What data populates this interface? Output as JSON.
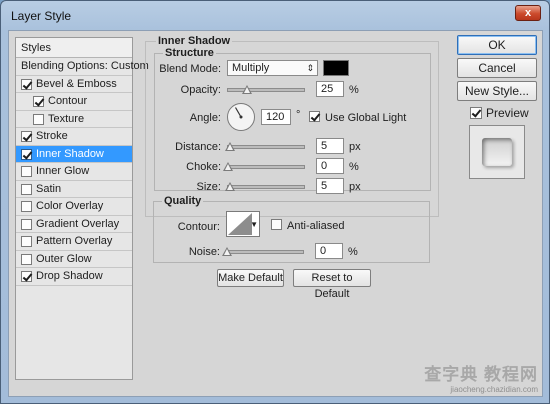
{
  "window": {
    "title": "Layer Style",
    "close_label": "x"
  },
  "styles_list": {
    "header": "Styles",
    "items": [
      {
        "label": "Blending Options: Custom",
        "checkbox": null,
        "indent": 0,
        "selected": false
      },
      {
        "label": "Bevel & Emboss",
        "checkbox": true,
        "indent": 0,
        "selected": false
      },
      {
        "label": "Contour",
        "checkbox": true,
        "indent": 1,
        "selected": false
      },
      {
        "label": "Texture",
        "checkbox": false,
        "indent": 1,
        "selected": false
      },
      {
        "label": "Stroke",
        "checkbox": true,
        "indent": 0,
        "selected": false
      },
      {
        "label": "Inner Shadow",
        "checkbox": true,
        "indent": 0,
        "selected": true
      },
      {
        "label": "Inner Glow",
        "checkbox": false,
        "indent": 0,
        "selected": false
      },
      {
        "label": "Satin",
        "checkbox": false,
        "indent": 0,
        "selected": false
      },
      {
        "label": "Color Overlay",
        "checkbox": false,
        "indent": 0,
        "selected": false
      },
      {
        "label": "Gradient Overlay",
        "checkbox": false,
        "indent": 0,
        "selected": false
      },
      {
        "label": "Pattern Overlay",
        "checkbox": false,
        "indent": 0,
        "selected": false
      },
      {
        "label": "Outer Glow",
        "checkbox": false,
        "indent": 0,
        "selected": false
      },
      {
        "label": "Drop Shadow",
        "checkbox": true,
        "indent": 0,
        "selected": false
      }
    ]
  },
  "panel": {
    "title": "Inner Shadow",
    "structure": {
      "legend": "Structure",
      "blend_mode_label": "Blend Mode:",
      "blend_mode_value": "Multiply",
      "shadow_color": "#000000",
      "opacity_label": "Opacity:",
      "opacity_value": "25",
      "opacity_unit": "%",
      "opacity_level": 0.25,
      "angle_label": "Angle:",
      "angle_value": "120",
      "angle_unit": "°",
      "use_global_light_label": "Use Global Light",
      "use_global_light_checked": true,
      "distance_label": "Distance:",
      "distance_value": "5",
      "distance_unit": "px",
      "distance_level": 0.02,
      "choke_label": "Choke:",
      "choke_value": "0",
      "choke_unit": "%",
      "choke_level": 0.0,
      "size_label": "Size:",
      "size_value": "5",
      "size_unit": "px",
      "size_level": 0.02
    },
    "quality": {
      "legend": "Quality",
      "contour_label": "Contour:",
      "anti_aliased_label": "Anti-aliased",
      "anti_aliased_checked": false,
      "noise_label": "Noise:",
      "noise_value": "0",
      "noise_unit": "%",
      "noise_level": 0.0
    },
    "make_default_label": "Make Default",
    "reset_default_label": "Reset to Default"
  },
  "actions": {
    "ok_label": "OK",
    "cancel_label": "Cancel",
    "new_style_label": "New Style...",
    "preview_label": "Preview",
    "preview_checked": true
  },
  "watermark": {
    "big": "查字典 教程网",
    "small": "jiaocheng.chazidian.com"
  },
  "colors": {
    "selection": "#3399ff",
    "dialog_bg": "#d6d6d6",
    "titlebar": "#a9c1dc"
  }
}
